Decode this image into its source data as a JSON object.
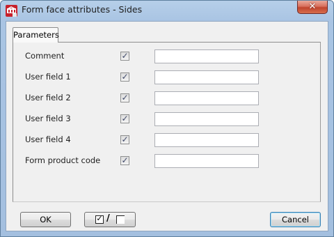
{
  "window": {
    "title": "Form face attributes - Sides",
    "close_glyph": "✕"
  },
  "tabs": [
    {
      "label": "Parameters"
    }
  ],
  "rows": [
    {
      "label": "Comment",
      "checked": true,
      "value": ""
    },
    {
      "label": "User field 1",
      "checked": true,
      "value": ""
    },
    {
      "label": "User field 2",
      "checked": true,
      "value": ""
    },
    {
      "label": "User field 3",
      "checked": true,
      "value": ""
    },
    {
      "label": "User field 4",
      "checked": true,
      "value": ""
    },
    {
      "label": "Form product code",
      "checked": true,
      "value": ""
    }
  ],
  "glyphs": {
    "check": "✓",
    "slash": "/"
  },
  "buttons": {
    "ok": "OK",
    "cancel": "Cancel",
    "toggle_icon": "check-all-uncheck-all-icon"
  },
  "colors": {
    "title_bar": "#a9c4e3",
    "close_button": "#c0442e",
    "default_button_border": "#3c7fb1"
  }
}
